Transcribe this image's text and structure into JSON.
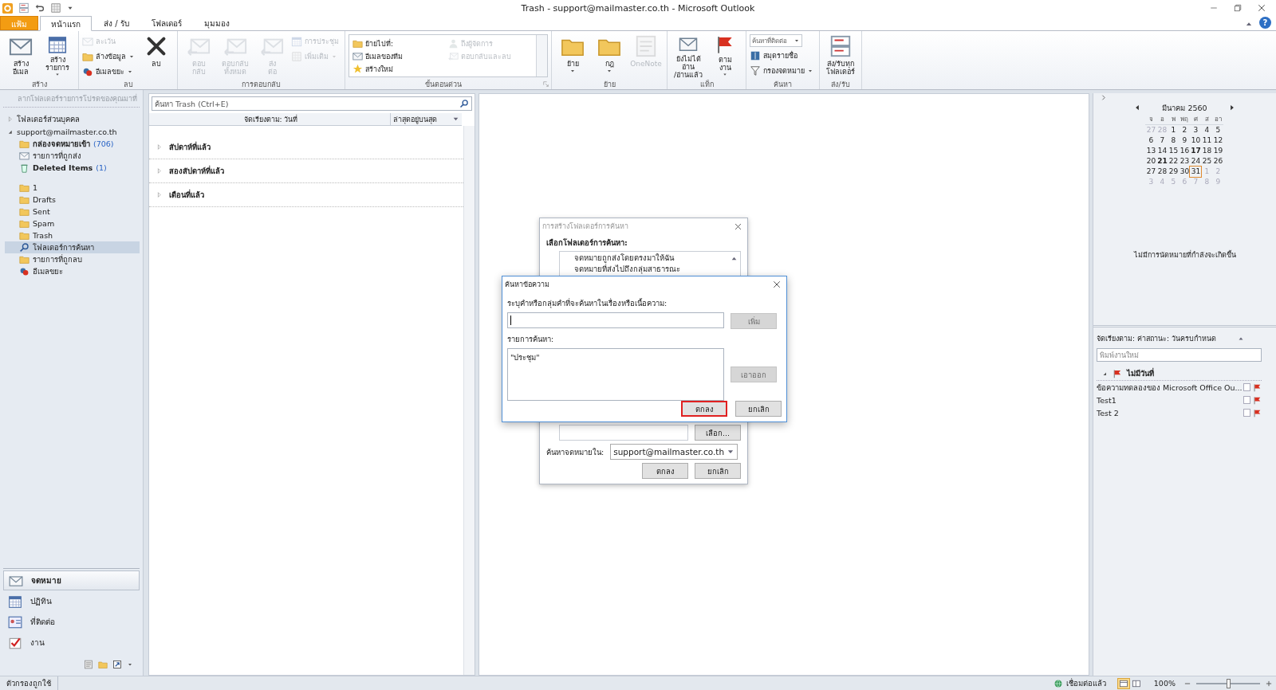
{
  "window": {
    "title": "Trash - support@mailmaster.co.th - Microsoft Outlook",
    "help": "?"
  },
  "ribbon": {
    "tabs": [
      {
        "label": "แฟ้ม",
        "kind": "file",
        "selected": false
      },
      {
        "label": "หน้าแรก",
        "kind": "tab",
        "selected": true
      },
      {
        "label": "ส่ง / รับ",
        "kind": "tab",
        "selected": false
      },
      {
        "label": "โฟลเดอร์",
        "kind": "tab",
        "selected": false
      },
      {
        "label": "มุมมอง",
        "kind": "tab",
        "selected": false
      }
    ],
    "groups": [
      {
        "label": "สร้าง",
        "launcher": false,
        "items": [
          {
            "kind": "large",
            "lines": [
              "สร้าง",
              "อีเมล"
            ],
            "menu": false,
            "disabled": false
          },
          {
            "kind": "large",
            "lines": [
              "สร้าง",
              "รายการ"
            ],
            "menu": true,
            "disabled": false
          }
        ]
      },
      {
        "label": "ลบ",
        "launcher": false,
        "items": [
          {
            "kind": "stack",
            "items": [
              {
                "kind": "small",
                "label": "ละเว้น",
                "menu": false,
                "disabled": true
              },
              {
                "kind": "small",
                "label": "ล้างข้อมูล",
                "menu": true,
                "disabled": false
              },
              {
                "kind": "small",
                "label": "อีเมลขยะ",
                "menu": true,
                "disabled": false
              }
            ]
          },
          {
            "kind": "large",
            "lines": [
              "ลบ"
            ],
            "menu": false,
            "disabled": false
          }
        ]
      },
      {
        "label": "การตอบกลับ",
        "launcher": false,
        "items": [
          {
            "kind": "large",
            "lines": [
              "ตอบ",
              "กลับ"
            ],
            "menu": false,
            "disabled": true
          },
          {
            "kind": "large",
            "lines": [
              "ตอบกลับ",
              "ทั้งหมด"
            ],
            "menu": false,
            "disabled": true
          },
          {
            "kind": "large",
            "lines": [
              "ส่ง",
              "ต่อ"
            ],
            "menu": false,
            "disabled": true
          },
          {
            "kind": "stack",
            "items": [
              {
                "kind": "small",
                "label": "การประชุม",
                "menu": false,
                "disabled": true
              },
              {
                "kind": "small",
                "label": "เพิ่มเติม",
                "menu": true,
                "disabled": true
              }
            ]
          }
        ]
      },
      {
        "label": "ขั้นตอนด่วน",
        "launcher": true,
        "items": [
          {
            "kind": "gallery",
            "items": [
              {
                "label": "ย้ายไปที่:",
                "disabled": false
              },
              {
                "label": "ถึงผู้จัดการ",
                "disabled": true
              },
              {
                "label": "อีเมลของทีม",
                "disabled": false
              },
              {
                "label": "ตอบกลับและลบ",
                "disabled": true
              },
              {
                "label": "สร้างใหม่",
                "disabled": false
              }
            ]
          }
        ]
      },
      {
        "label": "ย้าย",
        "launcher": false,
        "items": [
          {
            "kind": "large",
            "lines": [
              "ย้าย"
            ],
            "menu": true,
            "disabled": false
          },
          {
            "kind": "large",
            "lines": [
              "กฎ"
            ],
            "menu": true,
            "disabled": false
          },
          {
            "kind": "large",
            "lines": [
              "OneNote"
            ],
            "menu": false,
            "disabled": true
          }
        ]
      },
      {
        "label": "แท็ก",
        "launcher": false,
        "items": [
          {
            "kind": "large",
            "lines": [
              "ยังไม่ได้อ่าน",
              "/อ่านแล้ว"
            ],
            "menu": false,
            "disabled": false
          },
          {
            "kind": "large",
            "lines": [
              "ตาม",
              "งาน"
            ],
            "menu": true,
            "disabled": false
          }
        ]
      },
      {
        "label": "ค้นหา",
        "launcher": false,
        "items": [
          {
            "kind": "stack",
            "items": [
              {
                "kind": "combo",
                "label": "ค้นหาที่ติดต่อ",
                "menu": true,
                "disabled": false
              },
              {
                "kind": "small",
                "label": "สมุดรายชื่อ",
                "menu": false,
                "disabled": false
              },
              {
                "kind": "small",
                "label": "กรองจดหมาย",
                "menu": true,
                "disabled": false
              }
            ]
          }
        ]
      },
      {
        "label": "ส่ง/รับ",
        "launcher": false,
        "items": [
          {
            "kind": "large",
            "lines": [
              "ส่ง/รับทุก",
              "โฟลเดอร์"
            ],
            "menu": false,
            "disabled": false
          }
        ]
      }
    ]
  },
  "navigation": {
    "favorites_hint": "ลากโฟลเดอร์รายการโปรดของคุณมาที่",
    "tree": [
      {
        "label": "โฟลเดอร์ส่วนบุคคล",
        "expanded": false
      },
      {
        "label": "support@mailmaster.co.th",
        "expanded": true,
        "children": [
          {
            "label": "กล่องจดหมายเข้า",
            "count": "(706)",
            "unread": true,
            "selected": false,
            "kind": "special"
          },
          {
            "label": "รายการที่ถูกส่ง",
            "unread": false,
            "selected": false,
            "kind": "special"
          },
          {
            "label": "Deleted Items",
            "count": "(1)",
            "unread": true,
            "selected": false,
            "kind": "special"
          },
          {
            "label": "1",
            "unread": false,
            "selected": false,
            "kind": "folder"
          },
          {
            "label": "Drafts",
            "unread": false,
            "selected": false,
            "kind": "folder"
          },
          {
            "label": "Sent",
            "unread": false,
            "selected": false,
            "kind": "folder"
          },
          {
            "label": "Spam",
            "unread": false,
            "selected": false,
            "kind": "folder"
          },
          {
            "label": "Trash",
            "unread": false,
            "selected": false,
            "kind": "folder"
          },
          {
            "label": "โฟลเดอร์การค้นหา",
            "unread": false,
            "selected": true,
            "kind": "folder"
          },
          {
            "label": "รายการที่ถูกลบ",
            "unread": false,
            "selected": false,
            "kind": "folder"
          },
          {
            "label": "อีเมลขยะ",
            "unread": false,
            "selected": false,
            "kind": "folder"
          }
        ]
      }
    ],
    "modules": [
      {
        "label": "จดหมาย",
        "selected": true
      },
      {
        "label": "ปฏิทิน",
        "selected": false
      },
      {
        "label": "ที่ติดต่อ",
        "selected": false
      },
      {
        "label": "งาน",
        "selected": false
      }
    ]
  },
  "mail_list": {
    "search": {
      "placeholder": "ค้นหา Trash (Ctrl+E)"
    },
    "arrange_by": "จัดเรียงตาม: วันที่",
    "order": "ล่าสุดอยู่บนสุด",
    "groups": [
      {
        "label": "สัปดาห์ที่แล้ว",
        "expanded": false
      },
      {
        "label": "สองสัปดาห์ที่แล้ว",
        "expanded": false
      },
      {
        "label": "เดือนที่แล้ว",
        "expanded": false
      }
    ]
  },
  "search_folder_dialog": {
    "title": "การสร้างโฟลเดอร์การค้นหา",
    "heading": "เลือกโฟลเดอร์การค้นหา:",
    "options": [
      "จดหมายถูกส่งโดยตรงมาให้ฉัน",
      "จดหมายที่ส่งไปถึงกลุ่มสาธารณะ"
    ],
    "choose_button": "เลือก...",
    "search_in_label": "ค้นหาจดหมายใน:",
    "search_in_value": "support@mailmaster.co.th",
    "ok": "ตกลง",
    "cancel": "ยกเลิก"
  },
  "find_text_dialog": {
    "title": "ค้นหาข้อความ",
    "prompt": "ระบุคำหรือกลุ่มคำที่จะค้นหาในเรื่องหรือเนื้อความ:",
    "add_button": {
      "label": "เพิ่ม",
      "disabled": true
    },
    "list_label": "รายการค้นหา:",
    "terms": [
      "\"ประชุม\""
    ],
    "remove_button": {
      "label": "เอาออก",
      "disabled": true
    },
    "ok": {
      "label": "ตกลง",
      "highlighted": true
    },
    "cancel": {
      "label": "ยกเลิก",
      "highlighted": false
    }
  },
  "todo_bar": {
    "calendar": {
      "month": "มีนาคม 2560",
      "weekdays": [
        "จ",
        "อ",
        "พ",
        "พฤ",
        "ศ",
        "ส",
        "อา"
      ],
      "weeks": [
        [
          {
            "day": "27",
            "kind": "other"
          },
          {
            "day": "28",
            "kind": "other"
          },
          {
            "day": "1",
            "kind": "normal"
          },
          {
            "day": "2",
            "kind": "normal"
          },
          {
            "day": "3",
            "kind": "normal"
          },
          {
            "day": "4",
            "kind": "normal"
          },
          {
            "day": "5",
            "kind": "normal"
          }
        ],
        [
          {
            "day": "6",
            "kind": "normal"
          },
          {
            "day": "7",
            "kind": "normal"
          },
          {
            "day": "8",
            "kind": "normal"
          },
          {
            "day": "9",
            "kind": "normal"
          },
          {
            "day": "10",
            "kind": "normal"
          },
          {
            "day": "11",
            "kind": "normal"
          },
          {
            "day": "12",
            "kind": "normal"
          }
        ],
        [
          {
            "day": "13",
            "kind": "normal"
          },
          {
            "day": "14",
            "kind": "normal"
          },
          {
            "day": "15",
            "kind": "normal"
          },
          {
            "day": "16",
            "kind": "normal"
          },
          {
            "day": "17",
            "kind": "bold"
          },
          {
            "day": "18",
            "kind": "normal"
          },
          {
            "day": "19",
            "kind": "normal"
          }
        ],
        [
          {
            "day": "20",
            "kind": "normal"
          },
          {
            "day": "21",
            "kind": "bold"
          },
          {
            "day": "22",
            "kind": "normal"
          },
          {
            "day": "23",
            "kind": "normal"
          },
          {
            "day": "24",
            "kind": "normal"
          },
          {
            "day": "25",
            "kind": "normal"
          },
          {
            "day": "26",
            "kind": "normal"
          }
        ],
        [
          {
            "day": "27",
            "kind": "normal"
          },
          {
            "day": "28",
            "kind": "normal"
          },
          {
            "day": "29",
            "kind": "normal"
          },
          {
            "day": "30",
            "kind": "normal"
          },
          {
            "day": "31",
            "kind": "today"
          },
          {
            "day": "1",
            "kind": "other"
          },
          {
            "day": "2",
            "kind": "other"
          }
        ],
        [
          {
            "day": "3",
            "kind": "other"
          },
          {
            "day": "4",
            "kind": "other"
          },
          {
            "day": "5",
            "kind": "other"
          },
          {
            "day": "6",
            "kind": "other"
          },
          {
            "day": "7",
            "kind": "other"
          },
          {
            "day": "8",
            "kind": "other"
          },
          {
            "day": "9",
            "kind": "other"
          }
        ]
      ]
    },
    "appointments_note": "ไม่มีการนัดหมายที่กำลังจะเกิดขึ้น",
    "tasks": {
      "arrange_by": "จัดเรียงตาม: ค่าสถานะ: วันครบกำหนด",
      "new_task_placeholder": "พิมพ์งานใหม่",
      "group": {
        "label": "ไม่มีวันที่",
        "expanded": true
      },
      "items": [
        {
          "title": "ข้อความทดลองของ Microsoft Office Ou...",
          "completed": false
        },
        {
          "title": "Test1",
          "completed": false
        },
        {
          "title": "Test 2",
          "completed": false
        }
      ]
    }
  },
  "status_bar": {
    "filter": "ตัวกรองถูกใช้",
    "connection": "เชื่อมต่อแล้ว",
    "views": [
      {
        "selected": true
      },
      {
        "selected": false
      }
    ],
    "zoom": "100%",
    "zoom_slider": {
      "level": 0.5
    }
  }
}
